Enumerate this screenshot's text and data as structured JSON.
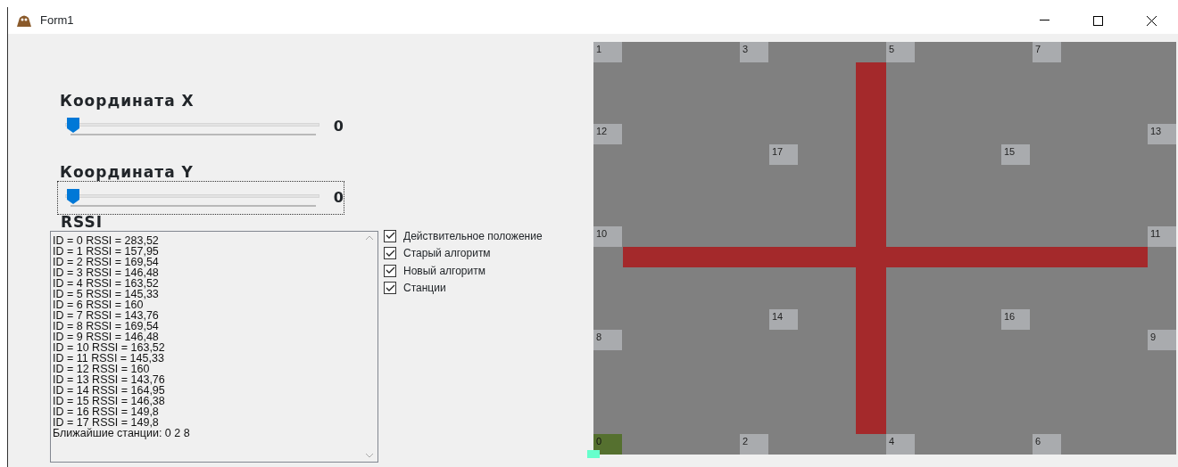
{
  "window": {
    "title": "Form1"
  },
  "sliders": [
    {
      "label": "Координата X",
      "level": 0,
      "value": "0",
      "focused": false
    },
    {
      "label": "Координата Y",
      "level": 0,
      "value": "0",
      "focused": true
    }
  ],
  "rssi": {
    "label": "RSSI",
    "lines": [
      "ID = 0 RSSI = 283,52",
      "ID = 1 RSSI = 157,95",
      "ID = 2 RSSI = 169,54",
      "ID = 3 RSSI = 146,48",
      "ID = 4 RSSI = 163,52",
      "ID = 5 RSSI = 145,33",
      "ID = 6 RSSI = 160",
      "ID = 7 RSSI = 143,76",
      "ID = 8 RSSI = 169,54",
      "ID = 9 RSSI = 146,48",
      "ID = 10 RSSI = 163,52",
      "ID = 11 RSSI = 145,33",
      "ID = 12 RSSI = 160",
      "ID = 13 RSSI = 143,76",
      "ID = 14 RSSI = 164,95",
      "ID = 15 RSSI = 146,38",
      "ID = 16 RSSI = 149,8",
      "ID = 17 RSSI = 149,8",
      "Ближайшие станции: 0  2  8"
    ]
  },
  "checkboxes": [
    {
      "label": "Действительное положение",
      "checked": true
    },
    {
      "label": "Старый  алгоритм",
      "checked": true
    },
    {
      "label": "Новый алгоритм",
      "checked": true
    },
    {
      "label": "Станции",
      "checked": true
    }
  ],
  "map": {
    "stations": [
      {
        "label": "1",
        "selected": false
      },
      {
        "label": "3",
        "selected": false
      },
      {
        "label": "5",
        "selected": false
      },
      {
        "label": "7",
        "selected": false
      },
      {
        "label": "12",
        "selected": false
      },
      {
        "label": "13",
        "selected": false
      },
      {
        "label": "17",
        "selected": false
      },
      {
        "label": "15",
        "selected": false
      },
      {
        "label": "10",
        "selected": false
      },
      {
        "label": "11",
        "selected": false
      },
      {
        "label": "14",
        "selected": false
      },
      {
        "label": "16",
        "selected": false
      },
      {
        "label": "8",
        "selected": false
      },
      {
        "label": "9",
        "selected": false
      },
      {
        "label": "0",
        "selected": true
      },
      {
        "label": "2",
        "selected": false
      },
      {
        "label": "4",
        "selected": false
      },
      {
        "label": "6",
        "selected": false
      }
    ]
  }
}
